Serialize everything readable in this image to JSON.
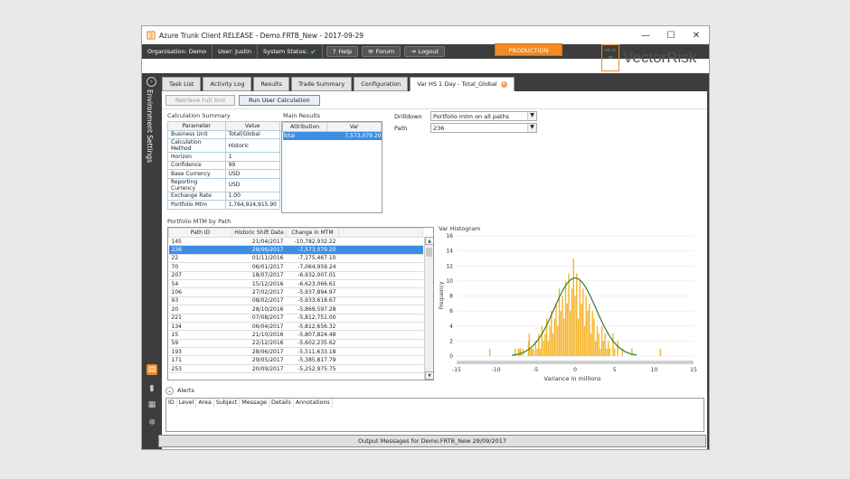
{
  "window": {
    "title": "Azure Trunk Client RELEASE - Demo.FRTB_New - 2017-09-29"
  },
  "status": {
    "organisation": "Organisation: Demo",
    "user": "User: Justin",
    "system_status": "System Status:",
    "help": "Help",
    "forum": "Forum",
    "logout": "Logout",
    "environment": "PRODUCTION",
    "logo_text": "VectorRisk",
    "logo_box": "ve ct or"
  },
  "sidebar": {
    "env_label": "Environment Settings"
  },
  "tabs": [
    {
      "label": "Task List"
    },
    {
      "label": "Activity Log"
    },
    {
      "label": "Results"
    },
    {
      "label": "Trade Summary"
    },
    {
      "label": "Configuration"
    },
    {
      "label": "Var HS 1 Day - Total_Global"
    }
  ],
  "toolbar": {
    "retrieve": "Retrieve Full Xml",
    "run": "Run User Calculation"
  },
  "calc_summary": {
    "title": "Calculation Summary",
    "headers": [
      "Parameter",
      "Value"
    ],
    "rows": [
      [
        "Business Unit",
        "Total|Global"
      ],
      [
        "Calculation Method",
        "Historic"
      ],
      [
        "Horizon",
        "1"
      ],
      [
        "Confidence",
        "99"
      ],
      [
        "Base Currency",
        "USD"
      ],
      [
        "Reporting Currency",
        "USD"
      ],
      [
        "Exchange Rate",
        "1.00"
      ],
      [
        "Portfolio Mtm",
        "1,764,924,915.90"
      ]
    ]
  },
  "main_results": {
    "title": "Main Results",
    "headers": [
      "Attribution",
      "Var"
    ],
    "rows": [
      [
        "Total",
        "7,573,079.20"
      ]
    ]
  },
  "drilldown": {
    "label": "Drilldown",
    "value": "Portfolio mtm on all paths",
    "path_label": "Path",
    "path_value": "236"
  },
  "portfolio_mtm": {
    "title": "Portfolio MTM by Path",
    "headers": [
      "Path ID",
      "Historic Shift Date",
      "Change in MTM"
    ],
    "rows": [
      [
        "145",
        "21/04/2017",
        "-10,782,932.22"
      ],
      [
        "236",
        "28/06/2017",
        "-7,573,079.20"
      ],
      [
        "22",
        "01/11/2016",
        "-7,175,467.10"
      ],
      [
        "70",
        "06/01/2017",
        "-7,064,959.24"
      ],
      [
        "207",
        "18/07/2017",
        "-6,932,007.01"
      ],
      [
        "54",
        "15/12/2016",
        "-6,623,066.61"
      ],
      [
        "106",
        "27/02/2017",
        "-5,937,894.97"
      ],
      [
        "93",
        "08/02/2017",
        "-5,933,618.67"
      ],
      [
        "20",
        "28/10/2016",
        "-5,869,597.28"
      ],
      [
        "221",
        "07/08/2017",
        "-5,812,751.00"
      ],
      [
        "134",
        "06/04/2017",
        "-5,812,656.32"
      ],
      [
        "15",
        "21/10/2016",
        "-5,807,824.48"
      ],
      [
        "59",
        "22/12/2016",
        "-5,602,235.62"
      ],
      [
        "193",
        "28/06/2017",
        "-5,511,633.18"
      ],
      [
        "171",
        "29/05/2017",
        "-5,385,817.79"
      ],
      [
        "253",
        "20/09/2017",
        "-5,252,975.75"
      ]
    ]
  },
  "chart_data": {
    "type": "bar",
    "title": "Var Histogram",
    "xlabel": "Variance in millions",
    "ylabel": "Frequency",
    "xlim": [
      -15,
      15
    ],
    "ylim": [
      0,
      16
    ],
    "xticks": [
      -15,
      -10,
      -5,
      0,
      5,
      10,
      15
    ],
    "yticks": [
      0,
      2,
      4,
      6,
      8,
      10,
      12,
      14,
      16
    ],
    "bar_color": "#f5b52a",
    "curve_color": "#2e7d32",
    "bins": [
      [
        -10.8,
        1
      ],
      [
        -7.6,
        1
      ],
      [
        -7.2,
        1
      ],
      [
        -7.0,
        1
      ],
      [
        -6.9,
        1
      ],
      [
        -6.6,
        1
      ],
      [
        -5.9,
        2
      ],
      [
        -5.8,
        3
      ],
      [
        -5.6,
        1
      ],
      [
        -5.5,
        1
      ],
      [
        -5.3,
        1
      ],
      [
        -5.0,
        2
      ],
      [
        -4.8,
        1
      ],
      [
        -4.6,
        3
      ],
      [
        -4.4,
        1
      ],
      [
        -4.2,
        4
      ],
      [
        -4.0,
        2
      ],
      [
        -3.8,
        3
      ],
      [
        -3.6,
        5
      ],
      [
        -3.4,
        2
      ],
      [
        -3.2,
        4
      ],
      [
        -3.0,
        6
      ],
      [
        -2.8,
        3
      ],
      [
        -2.6,
        5
      ],
      [
        -2.4,
        7
      ],
      [
        -2.2,
        4
      ],
      [
        -2.0,
        9
      ],
      [
        -1.8,
        6
      ],
      [
        -1.6,
        8
      ],
      [
        -1.4,
        5
      ],
      [
        -1.2,
        10
      ],
      [
        -1.0,
        7
      ],
      [
        -0.8,
        11
      ],
      [
        -0.6,
        6
      ],
      [
        -0.4,
        9
      ],
      [
        -0.2,
        13
      ],
      [
        0.0,
        8
      ],
      [
        0.2,
        11
      ],
      [
        0.4,
        5
      ],
      [
        0.6,
        10
      ],
      [
        0.8,
        7
      ],
      [
        1.0,
        9
      ],
      [
        1.2,
        4
      ],
      [
        1.4,
        8
      ],
      [
        1.6,
        6
      ],
      [
        1.8,
        7
      ],
      [
        2.0,
        3
      ],
      [
        2.2,
        6
      ],
      [
        2.4,
        5
      ],
      [
        2.6,
        2
      ],
      [
        2.8,
        4
      ],
      [
        3.0,
        3
      ],
      [
        3.2,
        1
      ],
      [
        3.4,
        4
      ],
      [
        3.6,
        2
      ],
      [
        3.8,
        3
      ],
      [
        4.0,
        1
      ],
      [
        4.2,
        2
      ],
      [
        4.4,
        1
      ],
      [
        4.8,
        3
      ],
      [
        5.0,
        1
      ],
      [
        5.4,
        2
      ],
      [
        6.0,
        1
      ],
      [
        7.2,
        1
      ],
      [
        10.8,
        1
      ]
    ],
    "normal": {
      "mean": 0,
      "sd": 2.65,
      "peak": 10.4
    }
  },
  "alerts": {
    "label": "Alerts",
    "columns": [
      "ID",
      "Level",
      "Area",
      "Subject",
      "Message",
      "Details",
      "Annotations"
    ]
  },
  "output_messages": "Output Messages for Demo.FRTB_New 29/09/2017"
}
